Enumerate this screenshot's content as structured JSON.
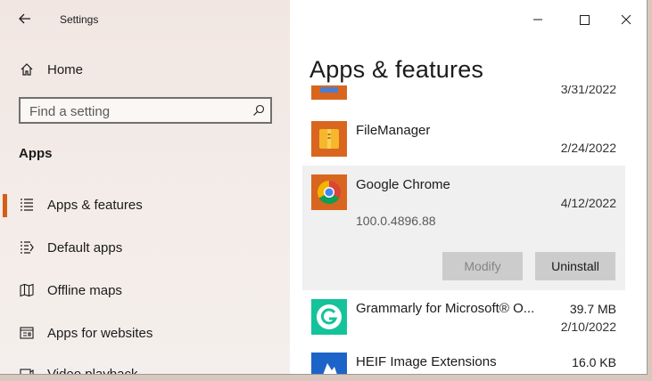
{
  "window": {
    "title": "Settings",
    "controls": [
      "minimize",
      "maximize",
      "close"
    ]
  },
  "sidebar": {
    "home_label": "Home",
    "search_placeholder": "Find a setting",
    "section_title": "Apps",
    "items": [
      {
        "label": "Apps & features",
        "icon": "apps-features-icon",
        "selected": true
      },
      {
        "label": "Default apps",
        "icon": "default-apps-icon",
        "selected": false
      },
      {
        "label": "Offline maps",
        "icon": "offline-maps-icon",
        "selected": false
      },
      {
        "label": "Apps for websites",
        "icon": "apps-websites-icon",
        "selected": false
      },
      {
        "label": "Video playback",
        "icon": "video-playback-icon",
        "selected": false
      }
    ],
    "accent_color": "#d45d15"
  },
  "main": {
    "title": "Apps & features",
    "apps": [
      {
        "name": "",
        "date": "3/31/2022",
        "icon": "app-icon-partial"
      },
      {
        "name": "FileManager",
        "date": "2/24/2022",
        "icon": "file-manager-icon"
      },
      {
        "name": "Google Chrome",
        "date": "4/12/2022",
        "version": "100.0.4896.88",
        "icon": "chrome-icon",
        "selected": true
      },
      {
        "name": "Grammarly for Microsoft® O...",
        "size": "39.7 MB",
        "date": "2/10/2022",
        "icon": "grammarly-icon"
      },
      {
        "name": "HEIF Image Extensions",
        "size": "16.0 KB",
        "icon": "heif-icon"
      }
    ],
    "buttons": {
      "modify": "Modify",
      "uninstall": "Uninstall"
    }
  }
}
